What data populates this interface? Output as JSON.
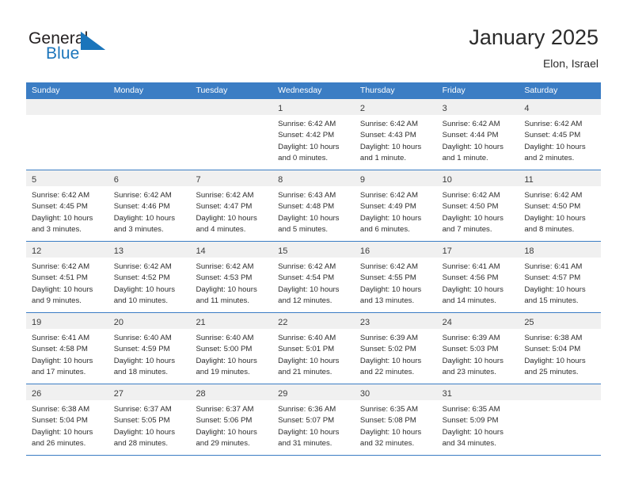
{
  "brand": {
    "name_part1": "General",
    "name_part2": "Blue",
    "mark_icon": "triangle-mark-icon",
    "accent_color": "#1b75bb"
  },
  "header": {
    "title": "January 2025",
    "subtitle": "Elon, Israel"
  },
  "calendar": {
    "header_bg": "#3b7dc4",
    "weekdays": [
      "Sunday",
      "Monday",
      "Tuesday",
      "Wednesday",
      "Thursday",
      "Friday",
      "Saturday"
    ],
    "weeks": [
      [
        {
          "day": "",
          "lines": []
        },
        {
          "day": "",
          "lines": []
        },
        {
          "day": "",
          "lines": []
        },
        {
          "day": "1",
          "lines": [
            "Sunrise: 6:42 AM",
            "Sunset: 4:42 PM",
            "Daylight: 10 hours",
            "and 0 minutes."
          ]
        },
        {
          "day": "2",
          "lines": [
            "Sunrise: 6:42 AM",
            "Sunset: 4:43 PM",
            "Daylight: 10 hours",
            "and 1 minute."
          ]
        },
        {
          "day": "3",
          "lines": [
            "Sunrise: 6:42 AM",
            "Sunset: 4:44 PM",
            "Daylight: 10 hours",
            "and 1 minute."
          ]
        },
        {
          "day": "4",
          "lines": [
            "Sunrise: 6:42 AM",
            "Sunset: 4:45 PM",
            "Daylight: 10 hours",
            "and 2 minutes."
          ]
        }
      ],
      [
        {
          "day": "5",
          "lines": [
            "Sunrise: 6:42 AM",
            "Sunset: 4:45 PM",
            "Daylight: 10 hours",
            "and 3 minutes."
          ]
        },
        {
          "day": "6",
          "lines": [
            "Sunrise: 6:42 AM",
            "Sunset: 4:46 PM",
            "Daylight: 10 hours",
            "and 3 minutes."
          ]
        },
        {
          "day": "7",
          "lines": [
            "Sunrise: 6:42 AM",
            "Sunset: 4:47 PM",
            "Daylight: 10 hours",
            "and 4 minutes."
          ]
        },
        {
          "day": "8",
          "lines": [
            "Sunrise: 6:43 AM",
            "Sunset: 4:48 PM",
            "Daylight: 10 hours",
            "and 5 minutes."
          ]
        },
        {
          "day": "9",
          "lines": [
            "Sunrise: 6:42 AM",
            "Sunset: 4:49 PM",
            "Daylight: 10 hours",
            "and 6 minutes."
          ]
        },
        {
          "day": "10",
          "lines": [
            "Sunrise: 6:42 AM",
            "Sunset: 4:50 PM",
            "Daylight: 10 hours",
            "and 7 minutes."
          ]
        },
        {
          "day": "11",
          "lines": [
            "Sunrise: 6:42 AM",
            "Sunset: 4:50 PM",
            "Daylight: 10 hours",
            "and 8 minutes."
          ]
        }
      ],
      [
        {
          "day": "12",
          "lines": [
            "Sunrise: 6:42 AM",
            "Sunset: 4:51 PM",
            "Daylight: 10 hours",
            "and 9 minutes."
          ]
        },
        {
          "day": "13",
          "lines": [
            "Sunrise: 6:42 AM",
            "Sunset: 4:52 PM",
            "Daylight: 10 hours",
            "and 10 minutes."
          ]
        },
        {
          "day": "14",
          "lines": [
            "Sunrise: 6:42 AM",
            "Sunset: 4:53 PM",
            "Daylight: 10 hours",
            "and 11 minutes."
          ]
        },
        {
          "day": "15",
          "lines": [
            "Sunrise: 6:42 AM",
            "Sunset: 4:54 PM",
            "Daylight: 10 hours",
            "and 12 minutes."
          ]
        },
        {
          "day": "16",
          "lines": [
            "Sunrise: 6:42 AM",
            "Sunset: 4:55 PM",
            "Daylight: 10 hours",
            "and 13 minutes."
          ]
        },
        {
          "day": "17",
          "lines": [
            "Sunrise: 6:41 AM",
            "Sunset: 4:56 PM",
            "Daylight: 10 hours",
            "and 14 minutes."
          ]
        },
        {
          "day": "18",
          "lines": [
            "Sunrise: 6:41 AM",
            "Sunset: 4:57 PM",
            "Daylight: 10 hours",
            "and 15 minutes."
          ]
        }
      ],
      [
        {
          "day": "19",
          "lines": [
            "Sunrise: 6:41 AM",
            "Sunset: 4:58 PM",
            "Daylight: 10 hours",
            "and 17 minutes."
          ]
        },
        {
          "day": "20",
          "lines": [
            "Sunrise: 6:40 AM",
            "Sunset: 4:59 PM",
            "Daylight: 10 hours",
            "and 18 minutes."
          ]
        },
        {
          "day": "21",
          "lines": [
            "Sunrise: 6:40 AM",
            "Sunset: 5:00 PM",
            "Daylight: 10 hours",
            "and 19 minutes."
          ]
        },
        {
          "day": "22",
          "lines": [
            "Sunrise: 6:40 AM",
            "Sunset: 5:01 PM",
            "Daylight: 10 hours",
            "and 21 minutes."
          ]
        },
        {
          "day": "23",
          "lines": [
            "Sunrise: 6:39 AM",
            "Sunset: 5:02 PM",
            "Daylight: 10 hours",
            "and 22 minutes."
          ]
        },
        {
          "day": "24",
          "lines": [
            "Sunrise: 6:39 AM",
            "Sunset: 5:03 PM",
            "Daylight: 10 hours",
            "and 23 minutes."
          ]
        },
        {
          "day": "25",
          "lines": [
            "Sunrise: 6:38 AM",
            "Sunset: 5:04 PM",
            "Daylight: 10 hours",
            "and 25 minutes."
          ]
        }
      ],
      [
        {
          "day": "26",
          "lines": [
            "Sunrise: 6:38 AM",
            "Sunset: 5:04 PM",
            "Daylight: 10 hours",
            "and 26 minutes."
          ]
        },
        {
          "day": "27",
          "lines": [
            "Sunrise: 6:37 AM",
            "Sunset: 5:05 PM",
            "Daylight: 10 hours",
            "and 28 minutes."
          ]
        },
        {
          "day": "28",
          "lines": [
            "Sunrise: 6:37 AM",
            "Sunset: 5:06 PM",
            "Daylight: 10 hours",
            "and 29 minutes."
          ]
        },
        {
          "day": "29",
          "lines": [
            "Sunrise: 6:36 AM",
            "Sunset: 5:07 PM",
            "Daylight: 10 hours",
            "and 31 minutes."
          ]
        },
        {
          "day": "30",
          "lines": [
            "Sunrise: 6:35 AM",
            "Sunset: 5:08 PM",
            "Daylight: 10 hours",
            "and 32 minutes."
          ]
        },
        {
          "day": "31",
          "lines": [
            "Sunrise: 6:35 AM",
            "Sunset: 5:09 PM",
            "Daylight: 10 hours",
            "and 34 minutes."
          ]
        },
        {
          "day": "",
          "lines": []
        }
      ]
    ]
  }
}
